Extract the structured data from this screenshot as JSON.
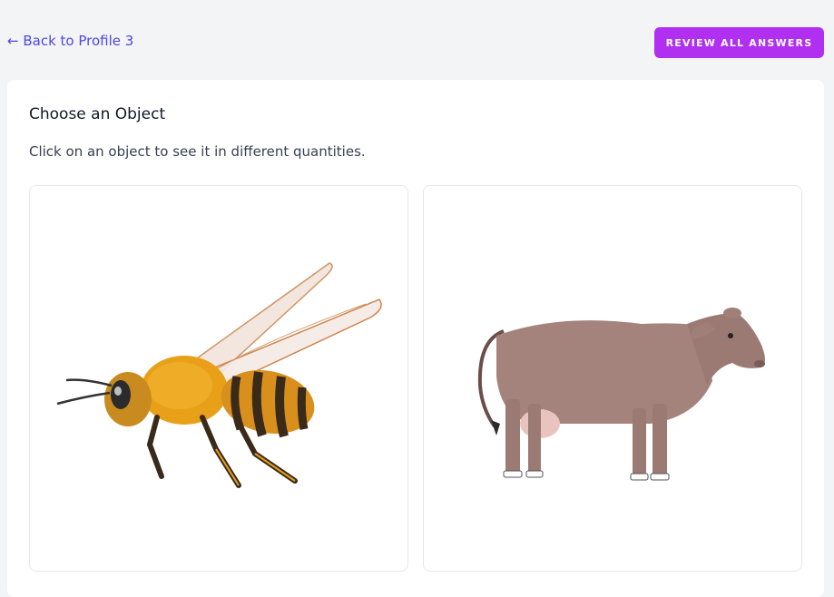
{
  "header": {
    "back_link": "← Back to Profile 3",
    "review_button": "REVIEW ALL ANSWERS"
  },
  "main": {
    "title": "Choose an Object",
    "description": "Click on an object to see it in different quantities.",
    "objects": [
      {
        "icon": "bee-illustration"
      },
      {
        "icon": "cow-illustration"
      }
    ]
  },
  "colors": {
    "accent": "#b02ff0",
    "link": "#4f46e5",
    "background": "#f3f4f6"
  }
}
